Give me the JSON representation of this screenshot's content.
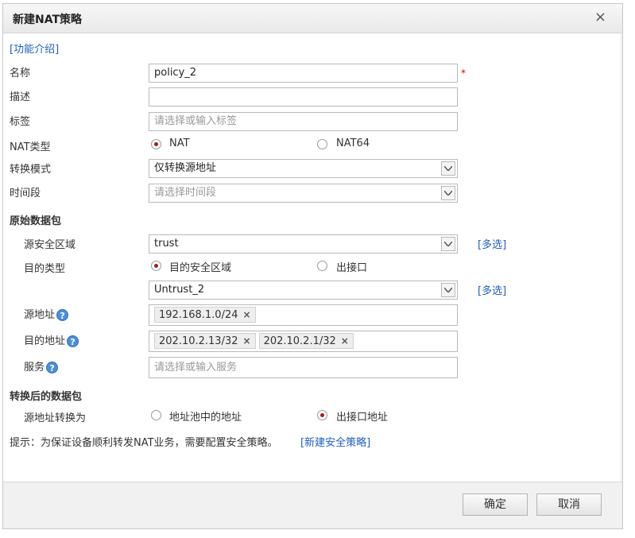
{
  "dialog": {
    "title": "新建NAT策略",
    "close_icon": "×"
  },
  "intro_link": "[功能介绍]",
  "fields": {
    "name_label": "名称",
    "name_value": "policy_2",
    "required_mark": "*",
    "desc_label": "描述",
    "desc_value": "",
    "tag_label": "标签",
    "tag_placeholder": "请选择或输入标签",
    "nat_type_label": "NAT类型",
    "nat_type_options": [
      "NAT",
      "NAT64"
    ],
    "nat_type_selected": "NAT",
    "mode_label": "转换模式",
    "mode_value": "仅转换源地址",
    "time_label": "时间段",
    "time_placeholder": "请选择时间段"
  },
  "original_packet": {
    "heading": "原始数据包",
    "src_zone_label": "源安全区域",
    "src_zone_value": "trust",
    "multi_select": "[多选]",
    "dst_type_label": "目的类型",
    "dst_type_options": [
      "目的安全区域",
      "出接口"
    ],
    "dst_type_selected": "目的安全区域",
    "dst_zone_value": "Untrust_2",
    "src_addr_label": "源地址",
    "src_addr_tags": [
      "192.168.1.0/24"
    ],
    "dst_addr_label": "目的地址",
    "dst_addr_tags": [
      "202.10.2.13/32",
      "202.10.2.1/32"
    ],
    "service_label": "服务",
    "service_placeholder": "请选择或输入服务",
    "help_glyph": "?"
  },
  "translated_packet": {
    "heading": "转换后的数据包",
    "src_translate_label": "源地址转换为",
    "options": [
      "地址池中的地址",
      "出接口地址"
    ],
    "selected": "出接口地址"
  },
  "hint": {
    "text": "提示：为保证设备顺利转发NAT业务，需要配置安全策略。",
    "link": "[新建安全策略]"
  },
  "buttons": {
    "ok": "确定",
    "cancel": "取消"
  },
  "tag_remove_glyph": "×"
}
